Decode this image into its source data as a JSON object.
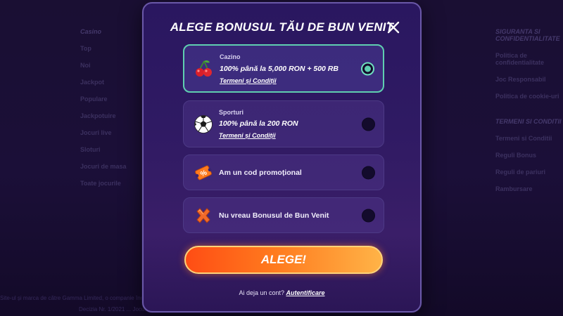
{
  "background": {
    "left_column": {
      "heading": "Casino",
      "items": [
        "Top",
        "Noi",
        "Jackpot",
        "Populare",
        "Jackpotuire",
        "Jocuri live",
        "Sloturi",
        "Jocuri de masa",
        "Toate jocurile"
      ]
    },
    "right_column": {
      "heading": "SIGURANTA SI CONFIDENTIALITATE",
      "items": [
        "Politica de confidentialitate",
        "Joc Responsabil",
        "Politica de cookie-uri"
      ]
    },
    "right_column_2": {
      "heading": "TERMENI SI CONDITII",
      "items": [
        "Termeni si Conditii",
        "Reguli Bonus",
        "Reguli de pariuri",
        "Rambursare"
      ]
    },
    "footer_line": "Site-ul și marca de către Gamma Limited, o companie înregistrată ... City Licentele/lor Consiliul Gamma Limited, 866/2001",
    "footer_line2": "Decizia Nr. 1/2021 ... Jocuri responsabile. ..."
  },
  "modal": {
    "title": "ALEGE BONUSUL TĂU DE BUN VENIT",
    "close_icon": "close-icon",
    "options": [
      {
        "icon": "cherries-icon",
        "label": "Cazino",
        "offer": "100% până la 5,000 RON + 500 RB",
        "terms": "Termeni și Condiții",
        "selected": true
      },
      {
        "icon": "soccer-ball-icon",
        "label": "Sporturi",
        "offer": "100% până la 200 RON",
        "terms": "Termeni și Condiții",
        "selected": false
      },
      {
        "icon": "promo-ticket-icon",
        "text": "Am un cod promoțional",
        "selected": false
      },
      {
        "icon": "cross-icon",
        "text": "Nu vreau Bonusul de Bun Venit",
        "selected": false
      }
    ],
    "cta_label": "ALEGE!",
    "login_prompt": "Ai deja un cont?",
    "login_link": "Autentificare"
  },
  "colors": {
    "accent_selected": "#5fcfb0",
    "cta_start": "#ff4d14",
    "cta_end": "#ffb347",
    "modal_bg": "#2f1a63"
  }
}
